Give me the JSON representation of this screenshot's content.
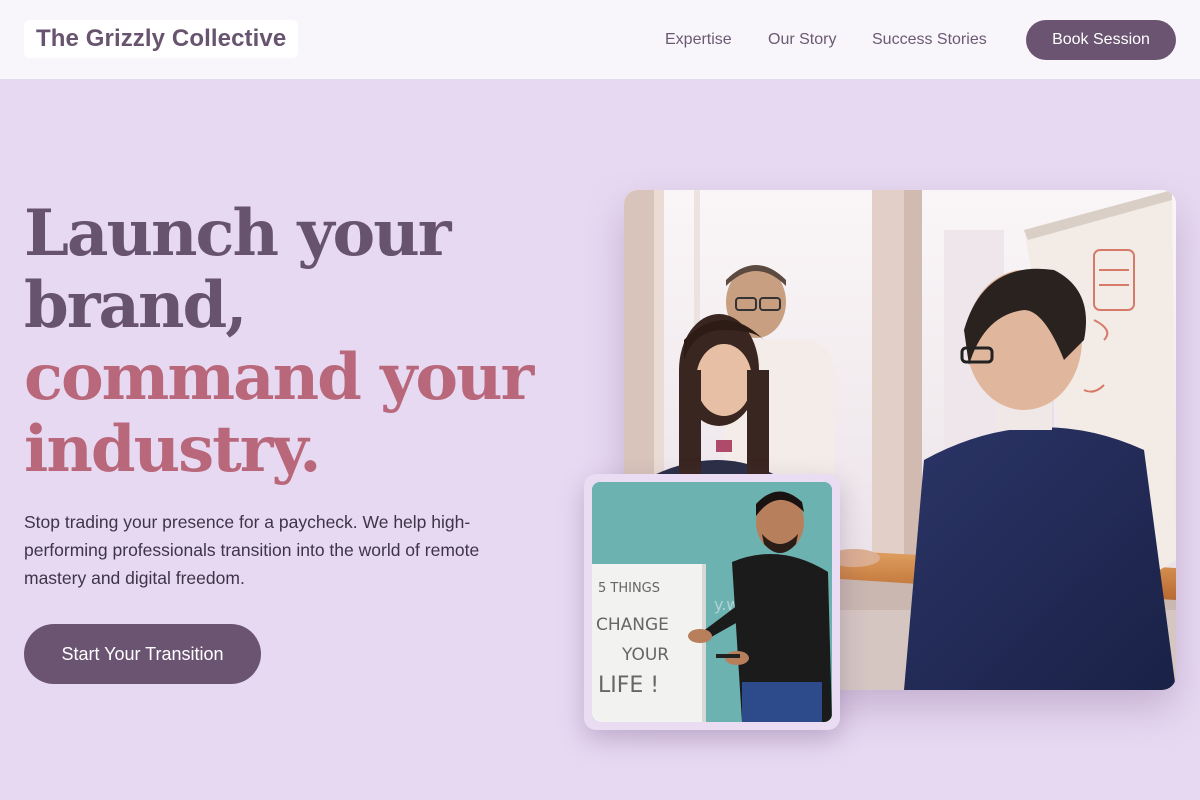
{
  "header": {
    "brand": "The Grizzly Collective",
    "nav": {
      "expertise": "Expertise",
      "story": "Our Story",
      "success": "Success Stories"
    },
    "cta": "Book Session"
  },
  "hero": {
    "headline_lines": [
      "Launch your",
      "brand,",
      "command your",
      "industry."
    ],
    "subtext": "Stop trading your presence for a paycheck. We help high-performing professionals transition into the world of remote mastery and digital freedom.",
    "cta": "Start Your Transition"
  },
  "images": {
    "main": "office-meeting-photo",
    "inset": "presenter-whiteboard-photo",
    "inset_board": [
      "5 THINGS",
      "CHANGE",
      "YOUR",
      "LIFE !"
    ],
    "inset_watermark": "y.work"
  },
  "colors": {
    "background": "#e8d9f2",
    "header": "#f8f6fb",
    "primary": "#6a5472",
    "accent": "#b8687a"
  }
}
